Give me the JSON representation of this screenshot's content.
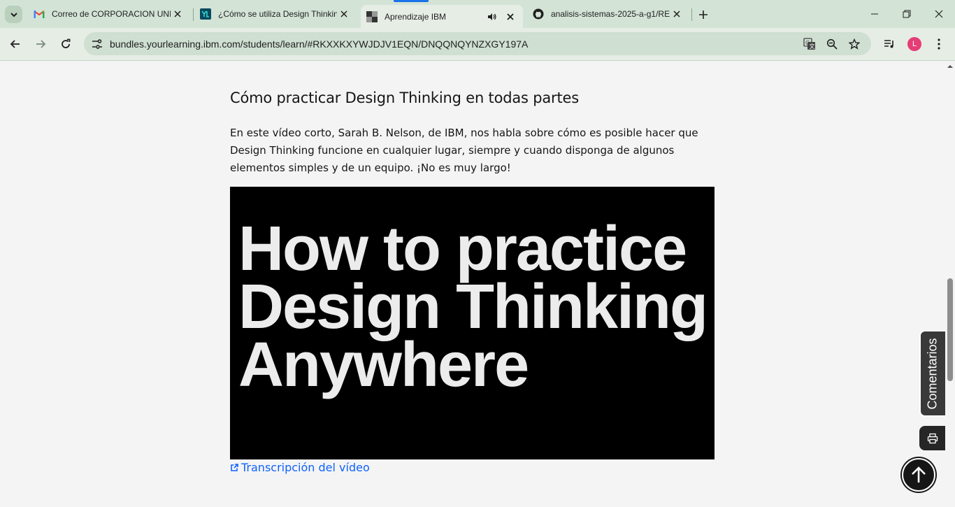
{
  "browser": {
    "tabs": [
      {
        "title": "Correo de CORPORACION UNIV",
        "favicon": "gmail-icon",
        "active": false
      },
      {
        "title": "¿Cómo se utiliza Design Thinkin",
        "favicon": "yourlearning-icon",
        "active": false
      },
      {
        "title": "Aprendizaje IBM",
        "favicon": "ibm-grid-icon",
        "active": true,
        "audio": true
      },
      {
        "title": "analisis-sistemas-2025-a-g1/RE",
        "favicon": "github-icon",
        "active": false
      }
    ],
    "url": "bundles.yourlearning.ibm.com/students/learn/#RKXXKXYWJDJV1EQN/DNQQNQYNZXGY197A",
    "profile_initial": "L"
  },
  "content": {
    "heading": "Cómo practicar Design Thinking en todas partes",
    "paragraph": "En este vídeo corto, Sarah B. Nelson, de IBM, nos habla sobre cómo es posible hacer que Design Thinking funcione en cualquier lugar, siempre y cuando disponga de algunos elementos simples y de un equipo. ¡No es muy largo!",
    "video_title_lines": [
      "How to practice",
      "Design Thinking",
      "Anywhere"
    ],
    "transcript_link": "Transcripción del vídeo"
  },
  "side_actions": {
    "comments_label": "Comentarios"
  },
  "colors": {
    "tabstrip": "#d3e3d6",
    "toolbar": "#e6ede5",
    "page_bg": "#f4f4f4",
    "link": "#0f62fe",
    "avatar": "#e53d75"
  }
}
